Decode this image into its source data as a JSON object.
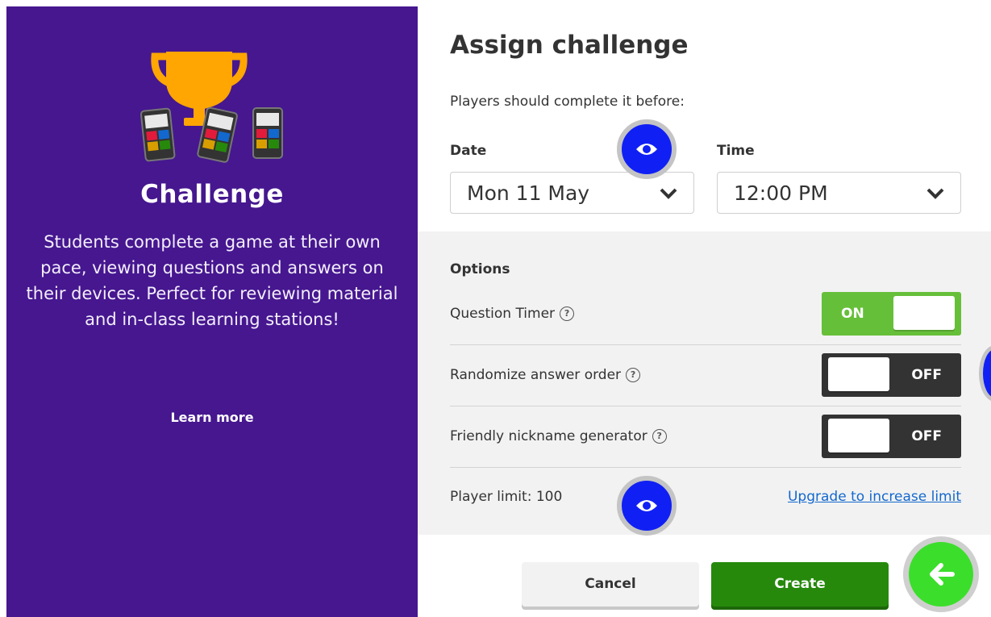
{
  "left_panel": {
    "title": "Challenge",
    "description": "Students complete a game at their own pace, viewing questions and answers on their devices. Perfect for reviewing material and in-class learning stations!",
    "learn_more": "Learn more",
    "illustration": "trophy-with-phones-icon"
  },
  "dialog": {
    "heading": "Assign challenge",
    "subtext": "Players should complete it before:",
    "date_label": "Date",
    "date_value": "Mon 11 May",
    "time_label": "Time",
    "time_value": "12:00 PM"
  },
  "options": {
    "heading": "Options",
    "help_glyph": "?",
    "items": [
      {
        "label": "Question Timer",
        "state": "ON"
      },
      {
        "label": "Randomize answer order",
        "state": "OFF"
      },
      {
        "label": "Friendly nickname generator",
        "state": "OFF"
      }
    ],
    "player_limit": "Player limit: 100",
    "upgrade_link": "Upgrade to increase limit"
  },
  "buttons": {
    "cancel": "Cancel",
    "create": "Create"
  },
  "colors": {
    "panel_purple": "#46178f",
    "toggle_on": "#66bf39",
    "toggle_off": "#333333",
    "create_green": "#26890c",
    "link_blue": "#1368ce",
    "overlay_blue": "#1020f4",
    "overlay_green": "#3cde2c"
  }
}
